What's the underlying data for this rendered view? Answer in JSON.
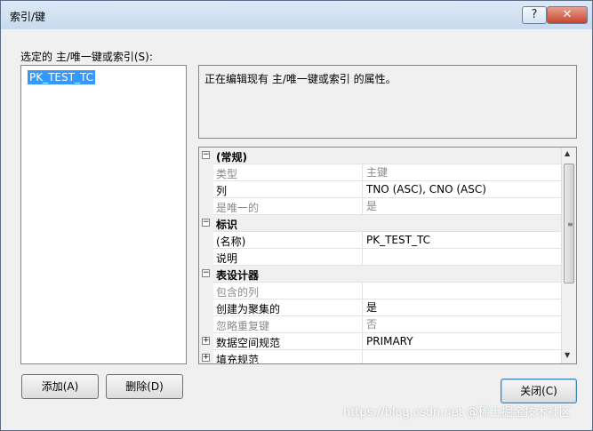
{
  "window": {
    "title": "索引/键",
    "help_glyph": "?",
    "close_glyph": "✕"
  },
  "left": {
    "label": "选定的 主/唯一键或索引(S):",
    "items": [
      "PK_TEST_TC"
    ]
  },
  "description": "正在编辑现有 主/唯一键或索引 的属性。",
  "grid": {
    "rows": [
      {
        "kind": "cat",
        "expander": "⊟",
        "name": "(常规)"
      },
      {
        "kind": "prop",
        "name": "类型",
        "value": "主键",
        "dim": true
      },
      {
        "kind": "prop",
        "name": "列",
        "value": "TNO (ASC), CNO (ASC)",
        "dim": false
      },
      {
        "kind": "prop",
        "name": "是唯一的",
        "value": "是",
        "dim": true
      },
      {
        "kind": "cat",
        "expander": "⊟",
        "name": "标识"
      },
      {
        "kind": "prop",
        "name": "(名称)",
        "value": "PK_TEST_TC",
        "dim": false
      },
      {
        "kind": "prop",
        "name": "说明",
        "value": "",
        "dim": false
      },
      {
        "kind": "cat",
        "expander": "⊟",
        "name": "表设计器"
      },
      {
        "kind": "prop",
        "name": "包含的列",
        "value": "",
        "dim": true
      },
      {
        "kind": "prop",
        "name": "创建为聚集的",
        "value": "是",
        "dim": false
      },
      {
        "kind": "prop",
        "name": "忽略重复键",
        "value": "否",
        "dim": true
      },
      {
        "kind": "expprop",
        "expander": "⊞",
        "name": "数据空间规范",
        "value": "PRIMARY"
      },
      {
        "kind": "expprop",
        "expander": "⊞",
        "name": "填充规范",
        "value": ""
      }
    ]
  },
  "buttons": {
    "add": "添加(A)",
    "delete": "删除(D)",
    "close": "关闭(C)"
  },
  "watermark": "https://blog.csdn.net @稀土掘金技术社区"
}
